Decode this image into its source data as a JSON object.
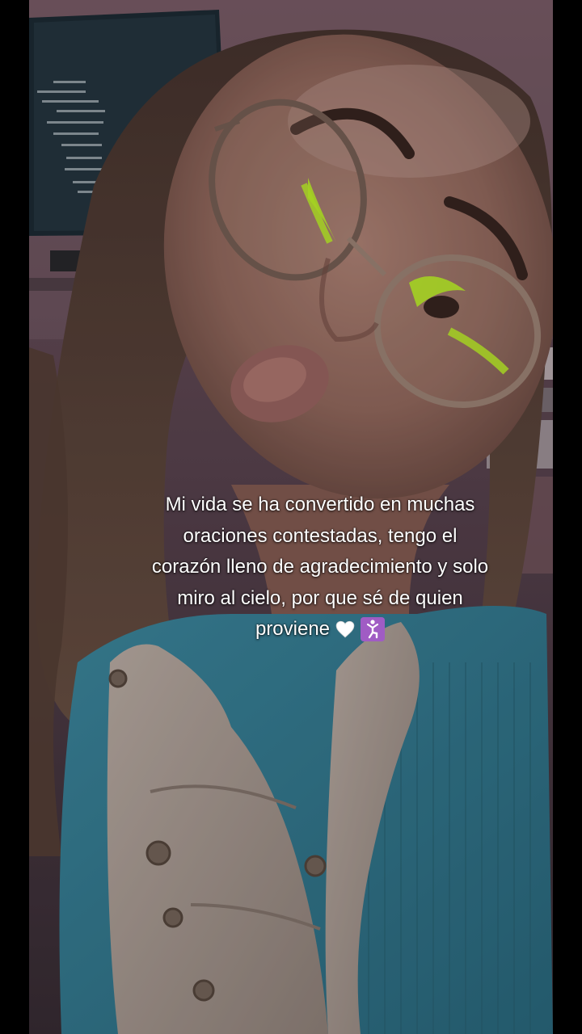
{
  "caption": {
    "line1": "Mi vida se ha convertido en muchas",
    "line2": "oraciones contestadas, tengo el",
    "line3": "corazón lleno de agradecimiento y solo",
    "line4": "miro al cielo, por que sé de quien",
    "line5": "proviene"
  },
  "emojis": {
    "heart_icon": "white-heart-icon",
    "pray_icon": "person-kneeling-icon"
  },
  "colors": {
    "letterbox": "#000000",
    "caption_text": "#ffffff",
    "shirt": "#3f8ea6",
    "vest": "#b9aaa2",
    "lens_highlight": "#c8ff2a",
    "emoji_badge": "#a05cc4"
  }
}
